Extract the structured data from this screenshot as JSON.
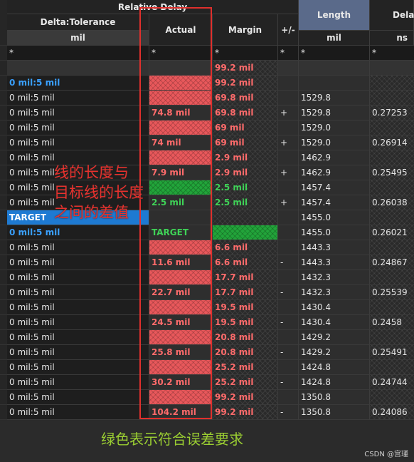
{
  "header": {
    "group_label": "Relative Delay",
    "delta_tolerance": "Delta:Tolerance",
    "delta_unit": "mil",
    "actual": "Actual",
    "margin": "Margin",
    "plus_minus": "+/-",
    "length": "Length",
    "length_unit": "mil",
    "delay": "Delay",
    "delay_unit": "ns"
  },
  "filter_row": [
    "*",
    "*",
    "*",
    "*",
    "*",
    "*"
  ],
  "rows": [
    {
      "delta": "",
      "actual": "",
      "margin": "99.2 mil",
      "pm": "",
      "length": "",
      "delay": "",
      "style": "blank"
    },
    {
      "delta": "0 mil:5 mil",
      "actual": "",
      "margin": "99.2 mil",
      "pm": "",
      "length": "",
      "delay": "",
      "style": "blue"
    },
    {
      "delta": "0 mil:5 mil",
      "actual": "",
      "margin": "69.8 mil",
      "pm": "",
      "length": "1529.8",
      "delay": "",
      "style": "red-empty"
    },
    {
      "delta": "0 mil:5 mil",
      "actual": "74.8 mil",
      "margin": "69.8 mil",
      "pm": "+",
      "length": "1529.8",
      "delay": "0.27253",
      "style": "plain"
    },
    {
      "delta": "0 mil:5 mil",
      "actual": "",
      "margin": "69 mil",
      "pm": "",
      "length": "1529.0",
      "delay": "",
      "style": "red-empty"
    },
    {
      "delta": "0 mil:5 mil",
      "actual": "74 mil",
      "margin": "69 mil",
      "pm": "+",
      "length": "1529.0",
      "delay": "0.26914",
      "style": "plain"
    },
    {
      "delta": "0 mil:5 mil",
      "actual": "",
      "margin": "2.9 mil",
      "pm": "",
      "length": "1462.9",
      "delay": "",
      "style": "red-empty"
    },
    {
      "delta": "0 mil:5 mil",
      "actual": "7.9 mil",
      "margin": "2.9 mil",
      "pm": "+",
      "length": "1462.9",
      "delay": "0.25495",
      "style": "plain"
    },
    {
      "delta": "0 mil:5 mil",
      "actual": "",
      "margin": "2.5 mil",
      "pm": "",
      "length": "1457.4",
      "delay": "",
      "style": "green-empty"
    },
    {
      "delta": "0 mil:5 mil",
      "actual": "2.5 mil",
      "margin": "2.5 mil",
      "pm": "+",
      "length": "1457.4",
      "delay": "0.26038",
      "style": "green-text"
    },
    {
      "delta": "TARGET",
      "actual": "",
      "margin": "",
      "pm": "",
      "length": "1455.0",
      "delay": "",
      "style": "target"
    },
    {
      "delta": "0 mil:5 mil",
      "actual": "TARGET",
      "margin": "",
      "pm": "",
      "length": "1455.0",
      "delay": "0.26021",
      "style": "target-sub"
    },
    {
      "delta": "0 mil:5 mil",
      "actual": "",
      "margin": "6.6 mil",
      "pm": "",
      "length": "1443.3",
      "delay": "",
      "style": "red-empty"
    },
    {
      "delta": "0 mil:5 mil",
      "actual": "11.6 mil",
      "margin": "6.6 mil",
      "pm": "-",
      "length": "1443.3",
      "delay": "0.24867",
      "style": "plain"
    },
    {
      "delta": "0 mil:5 mil",
      "actual": "",
      "margin": "17.7 mil",
      "pm": "",
      "length": "1432.3",
      "delay": "",
      "style": "red-empty"
    },
    {
      "delta": "0 mil:5 mil",
      "actual": "22.7 mil",
      "margin": "17.7 mil",
      "pm": "-",
      "length": "1432.3",
      "delay": "0.25539",
      "style": "plain"
    },
    {
      "delta": "0 mil:5 mil",
      "actual": "",
      "margin": "19.5 mil",
      "pm": "",
      "length": "1430.4",
      "delay": "",
      "style": "red-empty"
    },
    {
      "delta": "0 mil:5 mil",
      "actual": "24.5 mil",
      "margin": "19.5 mil",
      "pm": "-",
      "length": "1430.4",
      "delay": "0.2458",
      "style": "plain"
    },
    {
      "delta": "0 mil:5 mil",
      "actual": "",
      "margin": "20.8 mil",
      "pm": "",
      "length": "1429.2",
      "delay": "",
      "style": "red-empty"
    },
    {
      "delta": "0 mil:5 mil",
      "actual": "25.8 mil",
      "margin": "20.8 mil",
      "pm": "-",
      "length": "1429.2",
      "delay": "0.25491",
      "style": "plain"
    },
    {
      "delta": "0 mil:5 mil",
      "actual": "",
      "margin": "25.2 mil",
      "pm": "",
      "length": "1424.8",
      "delay": "",
      "style": "red-empty"
    },
    {
      "delta": "0 mil:5 mil",
      "actual": "30.2 mil",
      "margin": "25.2 mil",
      "pm": "-",
      "length": "1424.8",
      "delay": "0.24744",
      "style": "plain"
    },
    {
      "delta": "0 mil:5 mil",
      "actual": "",
      "margin": "99.2 mil",
      "pm": "",
      "length": "1350.8",
      "delay": "",
      "style": "red-empty"
    },
    {
      "delta": "0 mil:5 mil",
      "actual": "104.2 mil",
      "margin": "99.2 mil",
      "pm": "-",
      "length": "1350.8",
      "delay": "0.24086",
      "style": "plain"
    }
  ],
  "annotations": {
    "red_note_lines": [
      "线的长度与",
      "目标线的长度",
      "之间的差值"
    ],
    "green_note": "绿色表示符合误差要求",
    "watermark": "CSDN @宫瑾"
  },
  "colors": {
    "fail": "#e8585b",
    "pass": "#22a43a",
    "target": "#1e7ad2",
    "annotation": "#e0302d"
  }
}
